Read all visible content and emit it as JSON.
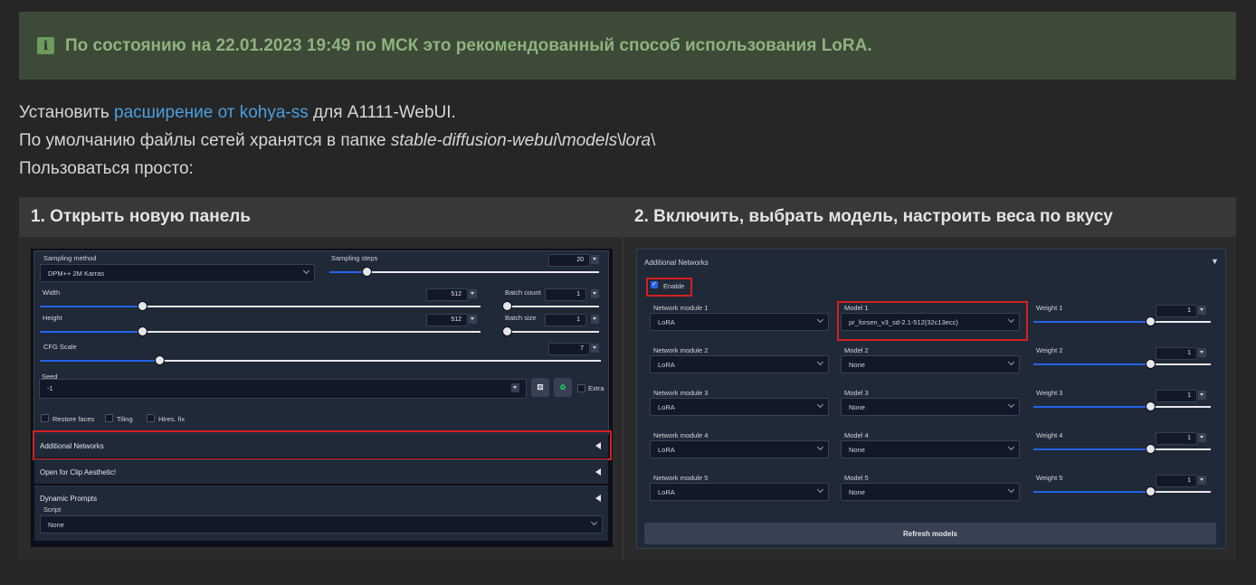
{
  "alert": {
    "icon": "info-icon",
    "text": "По состоянию на 22.01.2023 19:49 по МСК это рекомендованный способ использования LoRA."
  },
  "intro": {
    "line1_before": "Установить ",
    "line1_link": "расширение от kohya-ss",
    "line1_after": " для A1111-WebUI.",
    "line2_before": "По умолчанию файлы сетей хранятся в папке ",
    "line2_path": "stable-diffusion-webui",
    "line2_sep1": "\\",
    "line2_models": "models",
    "line2_sep2": "\\",
    "line2_lora": "lora",
    "line2_sep3": "\\",
    "line3": "Пользоваться просто:"
  },
  "table": {
    "col1": "1. Открыть новую панель",
    "col2": "2. Включить, выбрать модель, настроить веса по вкусу"
  },
  "shot1": {
    "sampling_method_label": "Sampling method",
    "sampling_method_value": "DPM++ 2M Karras",
    "sampling_steps_label": "Sampling steps",
    "sampling_steps_value": "20",
    "width_label": "Width",
    "width_value": "512",
    "batch_count_label": "Batch count",
    "batch_count_value": "1",
    "height_label": "Height",
    "height_value": "512",
    "batch_size_label": "Batch size",
    "batch_size_value": "1",
    "cfg_label": "CFG Scale",
    "cfg_value": "7",
    "seed_label": "Seed",
    "seed_value": "-1",
    "extra_label": "Extra",
    "restore_faces": "Restore faces",
    "tiling": "Tiling",
    "hires_fix": "Hires. fix",
    "acc1": "Additional Networks",
    "acc2": "Open for Clip Aesthetic!",
    "acc3": "Dynamic Prompts",
    "script_label": "Script",
    "script_value": "None"
  },
  "shot2": {
    "title": "Additional Networks",
    "enable": "Enable",
    "rows": [
      {
        "module_label": "Network module 1",
        "module": "LoRA",
        "model_label": "Model 1",
        "model": "pr_forsen_v3_sd-2.1-512(32c13ecc)",
        "weight_label": "Weight 1",
        "weight": "1"
      },
      {
        "module_label": "Network module 2",
        "module": "LoRA",
        "model_label": "Model 2",
        "model": "None",
        "weight_label": "Weight 2",
        "weight": "1"
      },
      {
        "module_label": "Network module 3",
        "module": "LoRA",
        "model_label": "Model 3",
        "model": "None",
        "weight_label": "Weight 3",
        "weight": "1"
      },
      {
        "module_label": "Network module 4",
        "module": "LoRA",
        "model_label": "Model 4",
        "model": "None",
        "weight_label": "Weight 4",
        "weight": "1"
      },
      {
        "module_label": "Network module 5",
        "module": "LoRA",
        "model_label": "Model 5",
        "model": "None",
        "weight_label": "Weight 5",
        "weight": "1"
      }
    ],
    "refresh": "Refresh models"
  },
  "colors": {
    "background": "#262626",
    "alert_bg": "#3c4a37",
    "alert_text": "#8fb27f",
    "link": "#4a9fe0",
    "highlight": "#d42020",
    "slider": "#2563eb"
  }
}
